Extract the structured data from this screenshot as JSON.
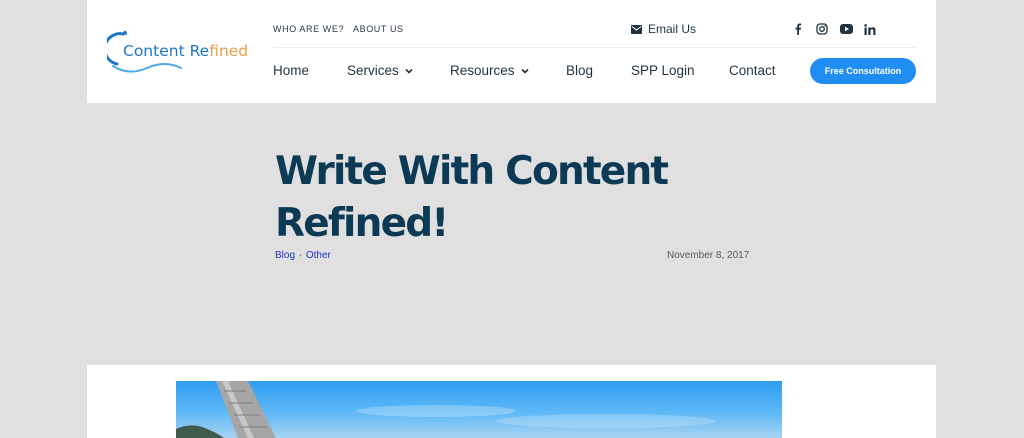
{
  "brand": {
    "part1": "Content Re",
    "part2": "fined"
  },
  "topbar": {
    "links": [
      "WHO ARE WE?",
      "ABOUT US"
    ],
    "email_label": "Email Us",
    "social_icons": [
      "facebook-icon",
      "instagram-icon",
      "youtube-icon",
      "linkedin-icon"
    ]
  },
  "nav": {
    "items": [
      {
        "label": "Home"
      },
      {
        "label": "Services"
      },
      {
        "label": "Resources"
      },
      {
        "label": "Blog"
      },
      {
        "label": "SPP Login"
      },
      {
        "label": "Contact"
      }
    ],
    "cta_label": "Free Consultation"
  },
  "post": {
    "title": "Write With Content Refined!",
    "categories": [
      "Blog",
      "Other"
    ],
    "date": "November 8, 2017"
  },
  "colors": {
    "page_background": "#e0e0e0",
    "title": "#0c3a55",
    "cta": "#1e8ef2",
    "link": "#2033c9",
    "brand_blue": "#1b77c4",
    "brand_orange": "#e8a04a"
  }
}
